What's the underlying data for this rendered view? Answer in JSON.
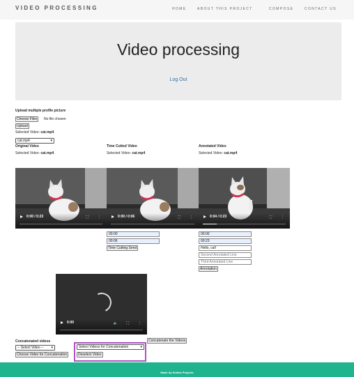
{
  "header": {
    "brand": "VIDEO PROCESSING",
    "nav": [
      "HOME",
      "ABOUT THIS PROJECT",
      "COMPOSE",
      "CONTACT US"
    ]
  },
  "hero": {
    "title": "Video processing",
    "logout": "Log Out"
  },
  "upload": {
    "heading": "Upload multiple profile picture",
    "choose_files": "Choose Files",
    "no_file": "No file chosen",
    "upload_button": "Upload",
    "selected_prefix": "Selected Video:",
    "selected_file": "cat.mp4",
    "dropdown_value": "cat.mp4"
  },
  "columns": [
    {
      "title": "Original Video",
      "selected_prefix": "Selected Video:",
      "selected_file": "cat.mp4"
    },
    {
      "title": "Time Cutted Video",
      "selected_prefix": "Selected Video:",
      "selected_file": "cat.mp4"
    },
    {
      "title": "Annotated Video",
      "selected_prefix": "Selected Video:",
      "selected_file": "cat.mp4"
    }
  ],
  "players": [
    {
      "time": "0:00 / 0:23",
      "progress": 0.0
    },
    {
      "time": "0:00 / 0:06",
      "progress": 0.0
    },
    {
      "time": "0:04 / 0:23",
      "progress": 0.17
    }
  ],
  "time_cut": {
    "start": "00:00",
    "end": "00:06",
    "send_button": "Time Cutting Send"
  },
  "annotation": {
    "start": "00:00",
    "end": "00:23",
    "line1": "Hello, cat!",
    "line2_placeholder": "Second Annotated Line",
    "line3_placeholder": "Third Annotated Line",
    "button": "Annotation"
  },
  "concat_player": {
    "time": "0:00"
  },
  "concat": {
    "label": "Concatenated videos",
    "concat_button": "Concatenate the Videos",
    "select_video": "-- Select Video --",
    "select_for_concat": "Select Videos for Concatenation",
    "choose_button": "Choose Video for Concatenation",
    "deselect_button": "Deselect Video"
  },
  "footer": {
    "text": "Made by Soldea Projects"
  }
}
